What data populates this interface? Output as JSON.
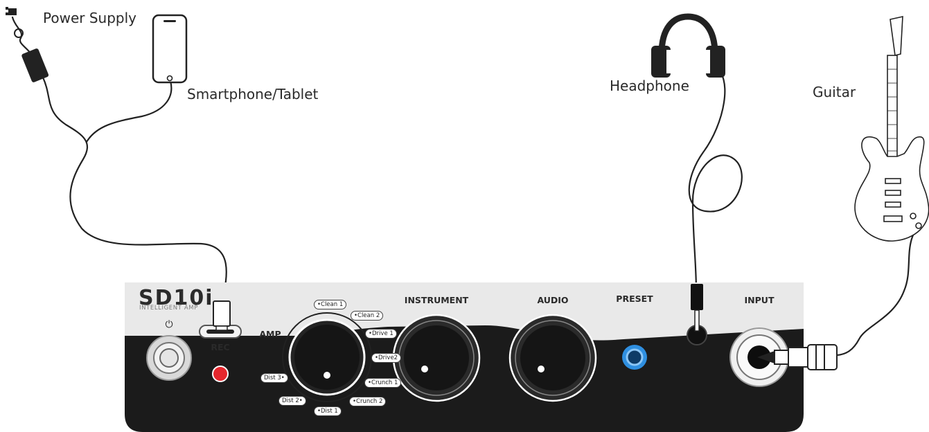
{
  "labels": {
    "power_supply": "Power Supply",
    "smartphone_tablet": "Smartphone/Tablet",
    "headphone": "Headphone",
    "guitar": "Guitar"
  },
  "device": {
    "brand": "SD10i",
    "brand_sub": "INTELLIGENT AMP",
    "power_symbol": "⏻",
    "rec": "REC",
    "amp": "AMP",
    "instrument": "INSTRUMENT",
    "audio": "AUDIO",
    "preset": "PRESET",
    "input": "INPUT",
    "amp_modes": {
      "clean1": "•Clean 1",
      "clean2": "•Clean 2",
      "drive1": "•Drive 1",
      "drive2": "•Drive2",
      "crunch1": "•Crunch 1",
      "crunch2": "•Crunch 2",
      "dist1": "•Dist 1",
      "dist2": "Dist 2•",
      "dist3": "Dist 3•"
    }
  },
  "colors": {
    "panel_top": "#e9e9e9",
    "panel_bottom": "#1b1b1b",
    "rec_led": "#e5272d",
    "preset_button": "#2f8fe0"
  }
}
